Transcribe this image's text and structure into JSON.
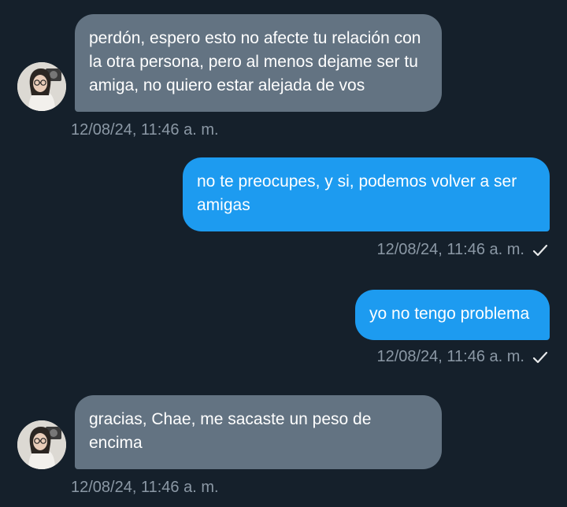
{
  "messages": [
    {
      "direction": "incoming",
      "text": "perdón, espero esto no afecte tu relación con la otra persona, pero al menos dejame ser tu amiga, no quiero estar alejada de vos",
      "timestamp": "12/08/24, 11:46 a. m."
    },
    {
      "direction": "outgoing",
      "text": "no te preocupes, y si, podemos volver a ser amigas",
      "timestamp": "12/08/24, 11:46 a. m.",
      "status_icon": "check-icon"
    },
    {
      "direction": "outgoing",
      "text": "yo no tengo problema",
      "timestamp": "12/08/24, 11:46 a. m.",
      "status_icon": "check-icon"
    },
    {
      "direction": "incoming",
      "text": "gracias, Chae, me sacaste un peso de encima",
      "timestamp": "12/08/24, 11:46 a. m."
    }
  ],
  "colors": {
    "background": "#15202b",
    "incoming_bubble": "#637382",
    "outgoing_bubble": "#1d9bf0",
    "timestamp": "#8b98a5"
  }
}
